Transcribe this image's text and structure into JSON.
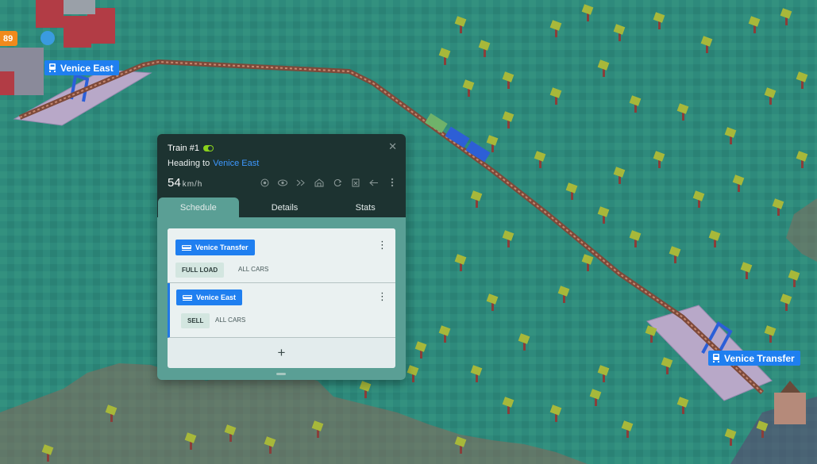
{
  "map": {
    "badge": "89",
    "labels": [
      {
        "id": "venice-east",
        "text": "Venice East"
      },
      {
        "id": "venice-transfer",
        "text": "Venice Transfer"
      }
    ]
  },
  "panel": {
    "train_name": "Train #1",
    "heading_prefix": "Heading to",
    "heading_dest": "Venice East",
    "speed_value": "54",
    "speed_unit": "km/h",
    "close_glyph": "✕",
    "tools": [
      "target-icon",
      "eye-icon",
      "fast-forward-icon",
      "depot-icon",
      "refresh-icon",
      "clipboard-icon",
      "reverse-icon",
      "more-icon"
    ],
    "tabs": [
      "Schedule",
      "Details",
      "Stats"
    ],
    "active_tab": "Schedule",
    "schedule": [
      {
        "station": "Venice Transfer",
        "action": "FULL LOAD",
        "cars": "ALL CARS",
        "selected": false
      },
      {
        "station": "Venice East",
        "action": "SELL",
        "cars": "ALL CARS",
        "selected": true
      }
    ],
    "add_glyph": "+"
  },
  "colors": {
    "grass": "#2e8a7c",
    "panel_dark": "#1d3331",
    "panel_body": "#5a9f95",
    "accent_blue": "#1f7ff0",
    "toggle_green": "#8ad21c",
    "badge_orange": "#f08a1c"
  }
}
